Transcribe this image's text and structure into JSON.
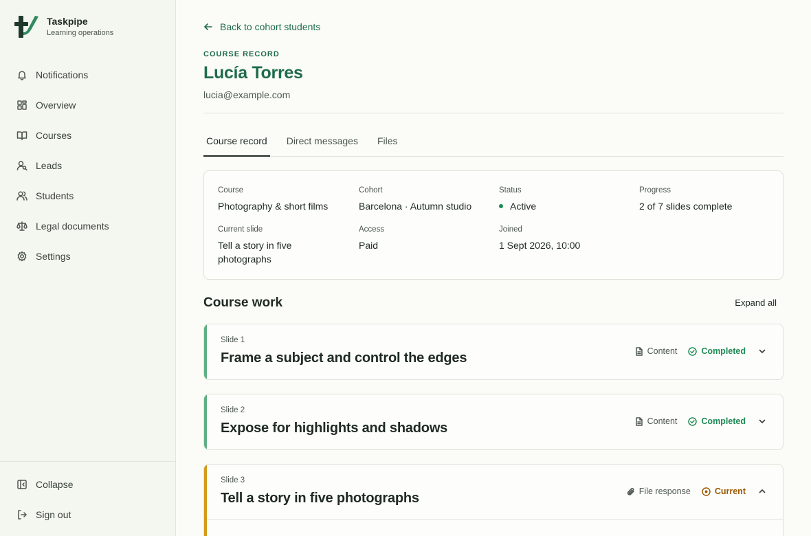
{
  "brand": {
    "name": "Taskpipe",
    "subtitle": "Learning operations"
  },
  "nav": [
    {
      "label": "Notifications",
      "icon": "bell-icon"
    },
    {
      "label": "Overview",
      "icon": "grid-icon"
    },
    {
      "label": "Courses",
      "icon": "book-icon"
    },
    {
      "label": "Leads",
      "icon": "user-search-icon"
    },
    {
      "label": "Students",
      "icon": "users-icon"
    },
    {
      "label": "Legal documents",
      "icon": "scale-icon"
    },
    {
      "label": "Settings",
      "icon": "gear-icon"
    }
  ],
  "sidebar_bottom": {
    "collapse": "Collapse",
    "sign_out": "Sign out"
  },
  "header": {
    "back": "Back to cohort students",
    "eyebrow": "COURSE RECORD",
    "name": "Lucía Torres",
    "email": "lucia@example.com"
  },
  "tabs": [
    "Course record",
    "Direct messages",
    "Files"
  ],
  "record": {
    "course_label": "Course",
    "course": "Photography & short films",
    "cohort_label": "Cohort",
    "cohort": "Barcelona · Autumn studio",
    "status_label": "Status",
    "status": "Active",
    "progress_label": "Progress",
    "progress": "2 of 7 slides complete",
    "current_label": "Current slide",
    "current": "Tell a story in five photographs",
    "access_label": "Access",
    "access": "Paid",
    "joined_label": "Joined",
    "joined": "1 Sept 2026, 10:00"
  },
  "course_work": {
    "title": "Course work",
    "expand_all": "Expand all",
    "slides": [
      {
        "num": "Slide 1",
        "title": "Frame a subject and control the edges",
        "type": "Content",
        "status": "Completed",
        "accent": "#5fae84",
        "status_color": "#1f8a55"
      },
      {
        "num": "Slide 2",
        "title": "Expose for highlights and shadows",
        "type": "Content",
        "status": "Completed",
        "accent": "#5fae84",
        "status_color": "#1f8a55"
      },
      {
        "num": "Slide 3",
        "title": "Tell a story in five photographs",
        "type": "File response",
        "status": "Current",
        "accent": "#d39a1c",
        "status_color": "#9a5a06"
      }
    ]
  },
  "colors": {
    "brand_green": "#1f6b4a",
    "completed": "#1f8a55",
    "current": "#9a5a06"
  }
}
